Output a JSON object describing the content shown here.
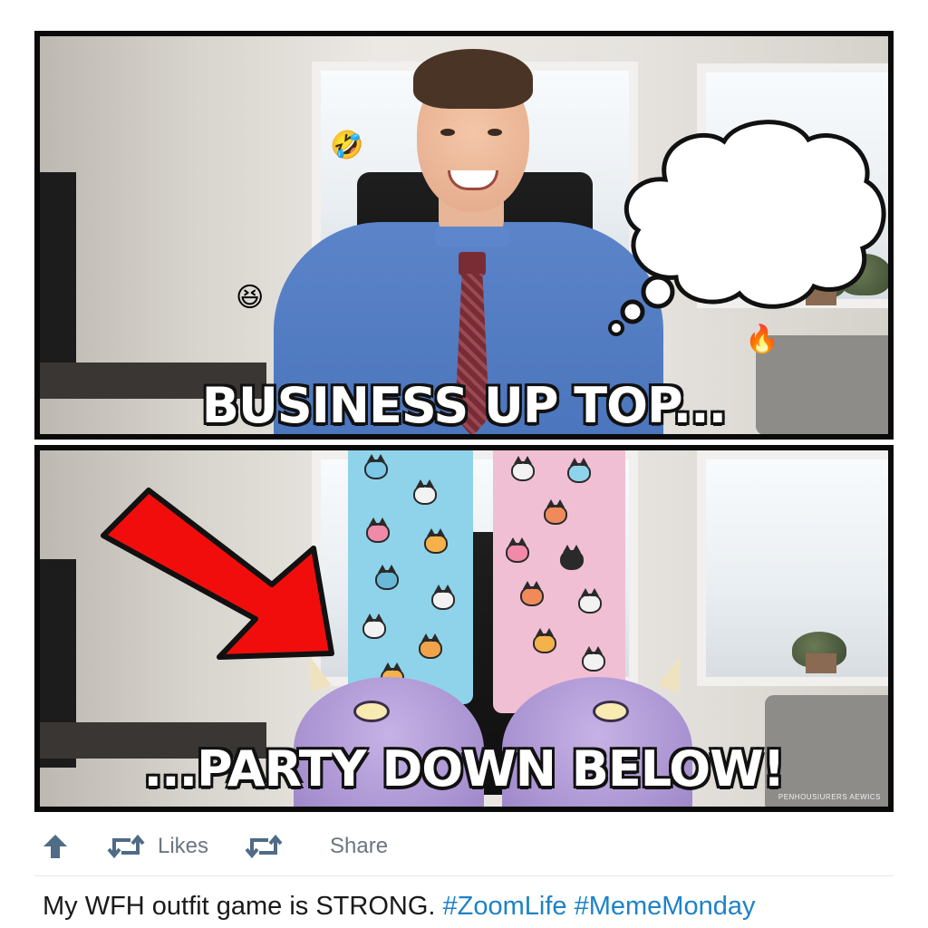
{
  "panels": {
    "top_caption": "BUSINESS UP TOP...",
    "bottom_caption": "...PARTY DOWN BELOW!",
    "watermark": "PENHOUSIURERS AEWICS"
  },
  "emojis": {
    "laugh_1": "🤣",
    "laugh_2": "😆",
    "fire": "🔥"
  },
  "actions": {
    "likes_label": "Likes",
    "share_label": "Share"
  },
  "post": {
    "text": "My WFH outfit game is STRONG.",
    "hashtags": [
      "#ZoomLife",
      "#MemeMonday"
    ]
  },
  "colors": {
    "accent_link": "#1d82c7",
    "icon_gray": "#4f6b85",
    "arrow_red": "#f20d0d"
  },
  "icons": [
    "upvote-arrow-icon",
    "retweet-icon",
    "share-retweet-icon"
  ]
}
